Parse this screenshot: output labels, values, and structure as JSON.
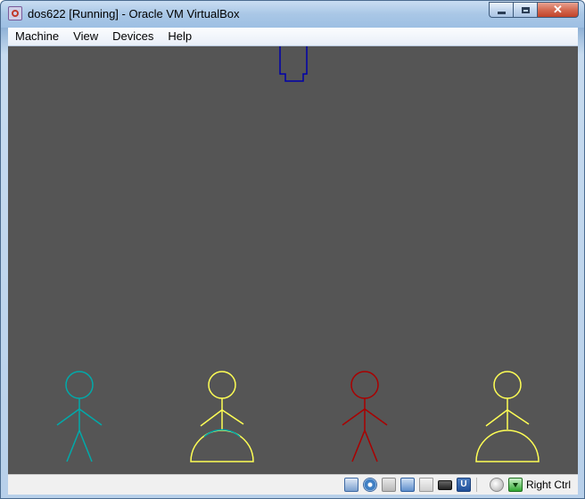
{
  "window": {
    "title": "dos622 [Running] - Oracle VM VirtualBox",
    "icon": "virtualbox-app-icon",
    "controls": [
      "minimize",
      "maximize",
      "close"
    ]
  },
  "menubar": {
    "items": [
      {
        "label": "Machine"
      },
      {
        "label": "View"
      },
      {
        "label": "Devices"
      },
      {
        "label": "Help"
      }
    ]
  },
  "guest_screen": {
    "background": "#555555",
    "ship_color": "#0000aa",
    "figures": [
      {
        "name": "cyan-stick-figure",
        "color": "#00aaaa",
        "arms": "down",
        "platform": false
      },
      {
        "name": "yellow-stick-figure-on-dome",
        "color": "#ffff55",
        "arms": "down",
        "platform": true,
        "dome_top_color": "#00aaaa"
      },
      {
        "name": "red-stick-figure",
        "color": "#aa0000",
        "arms": "down",
        "platform": false
      },
      {
        "name": "yellow-stick-figure-on-dome-2",
        "color": "#ffff55",
        "arms": "down",
        "platform": true,
        "dome_top_color": "#ffff55"
      }
    ]
  },
  "statusbar": {
    "icons": [
      "hard-disk-icon",
      "optical-drive-icon",
      "floppy-icon",
      "network-icon",
      "shared-folders-icon",
      "video-capture-icon",
      "usb-icon",
      "mouse-integration-icon",
      "host-key-icon"
    ],
    "host_key_label": "Right Ctrl"
  }
}
